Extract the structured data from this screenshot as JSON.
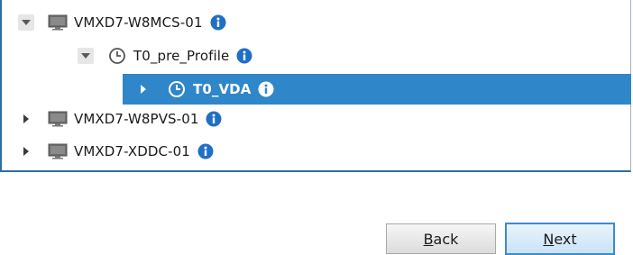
{
  "tree": {
    "items": [
      {
        "label": "VMXD7-W8MCS-01",
        "expander": "expanded",
        "icon": "monitor-icon",
        "selected": false
      },
      {
        "label": "T0_pre_Profile",
        "expander": "expanded",
        "icon": "clock-icon",
        "selected": false
      },
      {
        "label": "T0_VDA",
        "expander": "collapsed",
        "icon": "clock-icon",
        "selected": true
      },
      {
        "label": "VMXD7-W8PVS-01",
        "expander": "collapsed",
        "icon": "monitor-icon",
        "selected": false
      },
      {
        "label": "VMXD7-XDDC-01",
        "expander": "collapsed",
        "icon": "monitor-icon",
        "selected": false
      }
    ]
  },
  "buttons": {
    "back_label": "Back",
    "next_label": "Next"
  },
  "colors": {
    "selection": "#2f86c8",
    "info_icon": "#1f6fc5",
    "panel_border": "#2e6ea6"
  }
}
